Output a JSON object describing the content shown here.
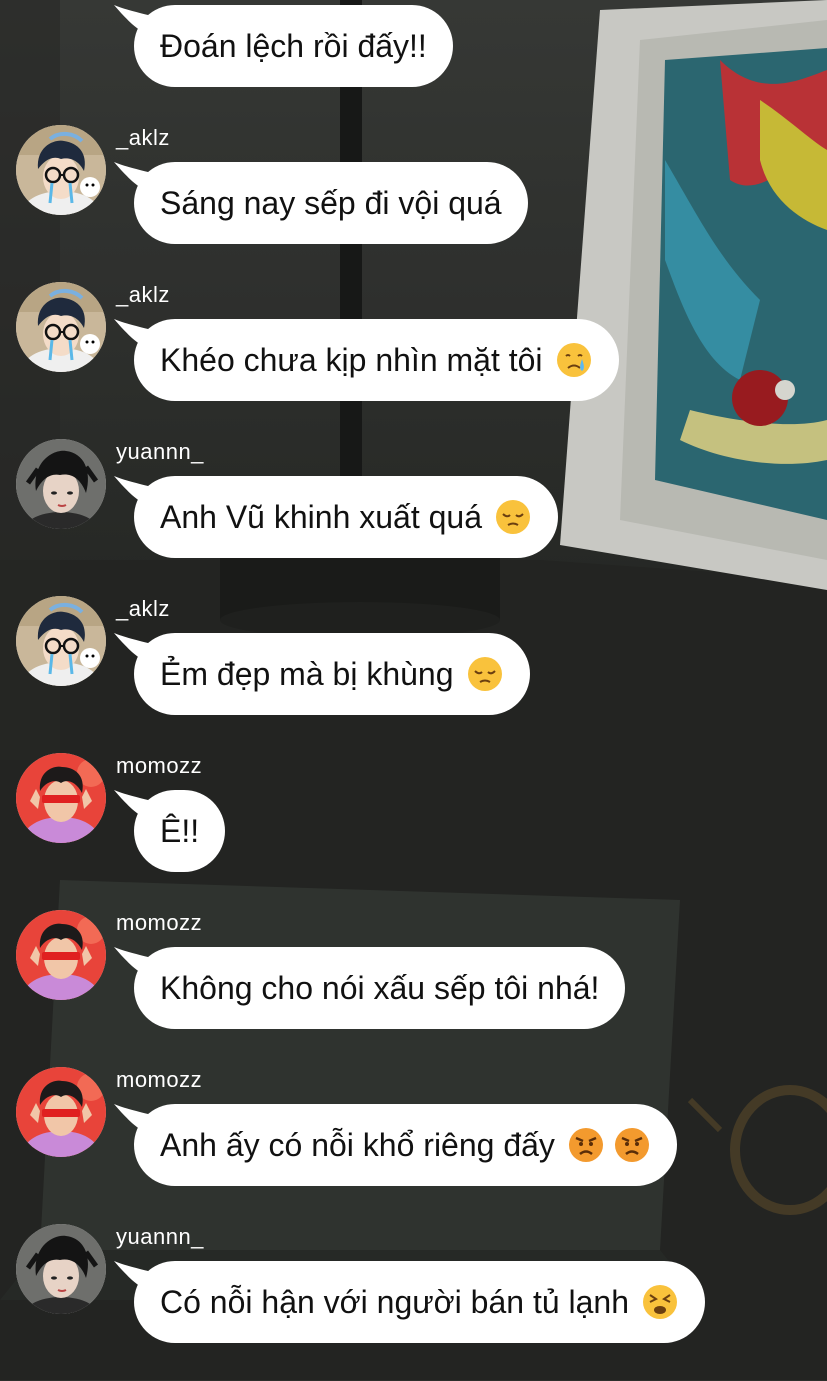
{
  "messages": [
    {
      "avatar": "momozz-avatar",
      "username": "",
      "text": "Đoán lệch rồi đấy!!",
      "emojis": []
    },
    {
      "avatar": "aklz-avatar",
      "username": "_aklz",
      "text": "Sáng nay sếp đi vội quá",
      "emojis": []
    },
    {
      "avatar": "aklz-avatar",
      "username": "_aklz",
      "text": "Khéo chưa kịp nhìn mặt tôi",
      "emojis": [
        "crying-face"
      ]
    },
    {
      "avatar": "yuannn-avatar",
      "username": "yuannn_",
      "text": "Anh Vũ khinh xuất quá",
      "emojis": [
        "pensive-face"
      ]
    },
    {
      "avatar": "aklz-avatar",
      "username": "_aklz",
      "text": "Ẻm đẹp mà bị khùng",
      "emojis": [
        "pensive-face"
      ]
    },
    {
      "avatar": "momozz-avatar",
      "username": "momozz",
      "text": "Ê!!",
      "emojis": []
    },
    {
      "avatar": "momozz-avatar",
      "username": "momozz",
      "text": "Không cho nói xấu sếp tôi nhá!",
      "emojis": []
    },
    {
      "avatar": "momozz-avatar",
      "username": "momozz",
      "text": "Anh ấy có nỗi khổ riêng đấy",
      "emojis": [
        "angry-face",
        "angry-face"
      ]
    },
    {
      "avatar": "yuannn-avatar",
      "username": "yuannn_",
      "text": "Có nỗi hận với người bán tủ lạnh",
      "emojis": [
        "weary-face"
      ]
    }
  ],
  "colors": {
    "bubble": "#ffffff",
    "username": "#ffffff",
    "message_text": "#111111",
    "background": "#2c2e2b"
  }
}
